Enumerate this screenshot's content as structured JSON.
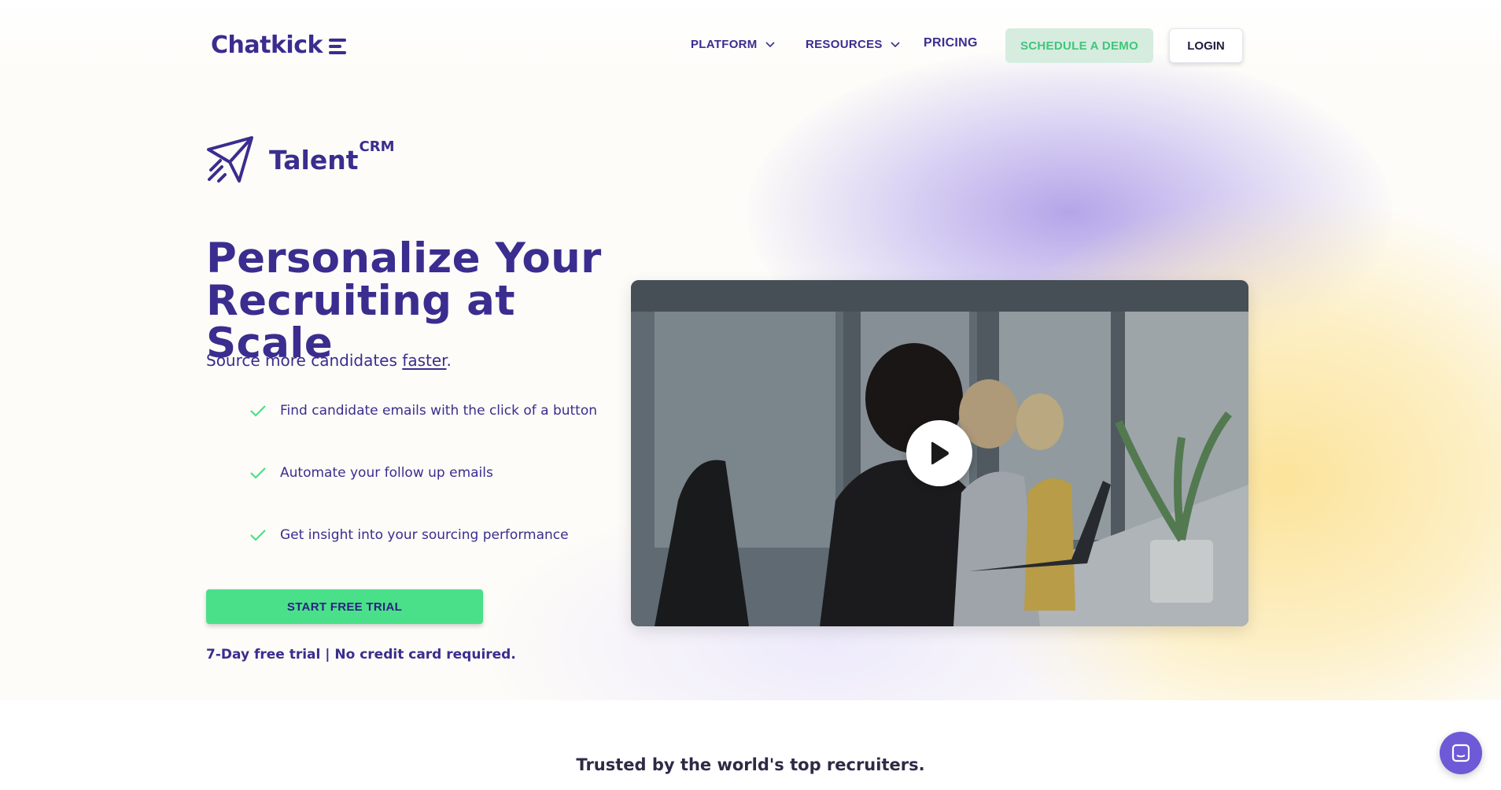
{
  "brand": {
    "logo_text": "Chatkick",
    "primary_color": "#3a2d8f",
    "accent_green": "#4ae08a"
  },
  "nav": {
    "items": [
      {
        "label": "PLATFORM",
        "has_dropdown": true
      },
      {
        "label": "RESOURCES",
        "has_dropdown": true
      },
      {
        "label": "PRICING",
        "has_dropdown": false
      }
    ],
    "demo_label": "SCHEDULE A DEMO",
    "login_label": "LOGIN"
  },
  "product": {
    "name": "Talent",
    "superscript": "CRM",
    "icon": "paper-plane-icon"
  },
  "hero": {
    "headline_line1": "Personalize Your",
    "headline_line2": "Recruiting at Scale",
    "subline_prefix": "Source more candidates ",
    "subline_emphasis": "faster",
    "subline_suffix": ".",
    "features": [
      "Find candidate emails with the click of a button",
      "Automate your follow up emails",
      "Get insight into your sourcing performance"
    ],
    "cta_label": "START FREE TRIAL",
    "trial_note": "7-Day free trial | No credit card required."
  },
  "video": {
    "icon": "play-icon"
  },
  "trusted": {
    "label": "Trusted by the world's top recruiters."
  },
  "chat": {
    "icon": "chat-icon"
  }
}
